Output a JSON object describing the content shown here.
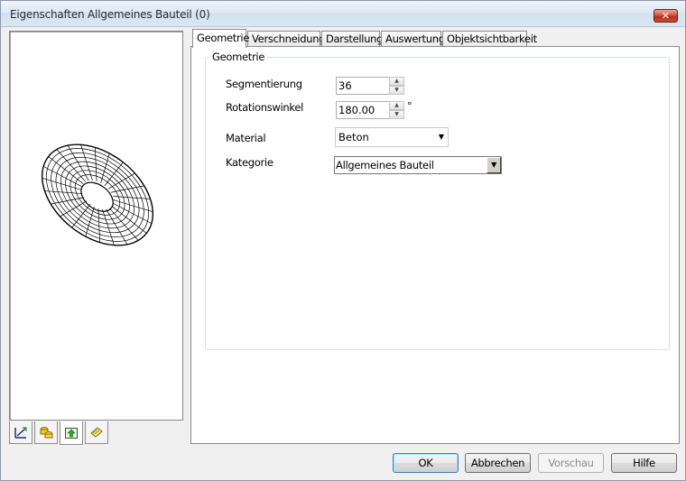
{
  "window": {
    "title": "Eigenschaften Allgemeines Bauteil (0)",
    "close_icon": "close-icon"
  },
  "preview": {
    "image": "torus-wireframe-preview",
    "tabs": [
      {
        "icon": "dimension-icon",
        "active": false
      },
      {
        "icon": "coins-icon",
        "active": false
      },
      {
        "icon": "green-arrow-icon",
        "active": true
      },
      {
        "icon": "layer-icon",
        "active": false
      }
    ]
  },
  "tabs": [
    "Geometrie",
    "Verschneidung",
    "Darstellung",
    "Auswertung",
    "Objektsichtbarkeit"
  ],
  "active_tab": "Geometrie",
  "group": {
    "title": "Geometrie",
    "segmentierung": {
      "label": "Segmentierung",
      "value": "36"
    },
    "rotationswinkel": {
      "label": "Rotationswinkel",
      "value": "180.00",
      "unit": "°"
    },
    "material": {
      "label": "Material",
      "value": "Beton"
    },
    "kategorie": {
      "label": "Kategorie",
      "value": "Allgemeines Bauteil"
    }
  },
  "buttons": {
    "ok": "OK",
    "cancel": "Abbrechen",
    "preview": "Vorschau",
    "help": "Hilfe"
  }
}
